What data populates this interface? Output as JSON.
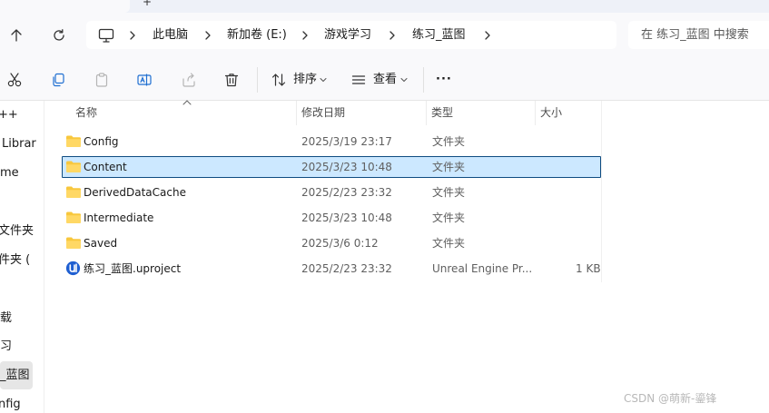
{
  "tab_strip": {
    "new_tab_label": "+"
  },
  "address_bar": {
    "breadcrumbs": [
      "此电脑",
      "新加卷 (E:)",
      "游戏学习",
      "练习_蓝图"
    ]
  },
  "search": {
    "placeholder": "在 练习_蓝图 中搜索"
  },
  "commandbar": {
    "sort_label": "排序",
    "view_label": "查看",
    "more_label": "···"
  },
  "sidebar": {
    "items": [
      {
        "label": "++"
      },
      {
        "label": "Librar"
      },
      {
        "label": "me"
      },
      {
        "label": ""
      },
      {
        "label": "文件夹"
      },
      {
        "label": "件夹 ("
      },
      {
        "label": ""
      },
      {
        "label": "载"
      },
      {
        "label": "习"
      },
      {
        "label": "_蓝图"
      },
      {
        "label": "nfig"
      }
    ]
  },
  "columns": {
    "name": "名称",
    "modified": "修改日期",
    "type": "类型",
    "size": "大小"
  },
  "files": [
    {
      "name": "Config",
      "modified": "2025/3/19 23:17",
      "type": "文件夹",
      "size": "",
      "icon": "folder-icon"
    },
    {
      "name": "Content",
      "modified": "2025/3/23 10:48",
      "type": "文件夹",
      "size": "",
      "icon": "folder-icon"
    },
    {
      "name": "DerivedDataCache",
      "modified": "2025/2/23 23:32",
      "type": "文件夹",
      "size": "",
      "icon": "folder-icon"
    },
    {
      "name": "Intermediate",
      "modified": "2025/3/23 10:48",
      "type": "文件夹",
      "size": "",
      "icon": "folder-icon"
    },
    {
      "name": "Saved",
      "modified": "2025/3/6 0:12",
      "type": "文件夹",
      "size": "",
      "icon": "folder-icon"
    },
    {
      "name": "练习_蓝图.uproject",
      "modified": "2025/2/23 23:32",
      "type": "Unreal Engine Pr...",
      "size": "1 KB",
      "icon": "unreal-engine-icon"
    }
  ],
  "watermark": "CSDN @萌新-鎏锋",
  "colors": {
    "selection_fill": "#cce8ff",
    "selection_border": "#0f4c81",
    "folder_yellow": "#f8c73d",
    "unreal_blue": "#1f5fd1"
  }
}
